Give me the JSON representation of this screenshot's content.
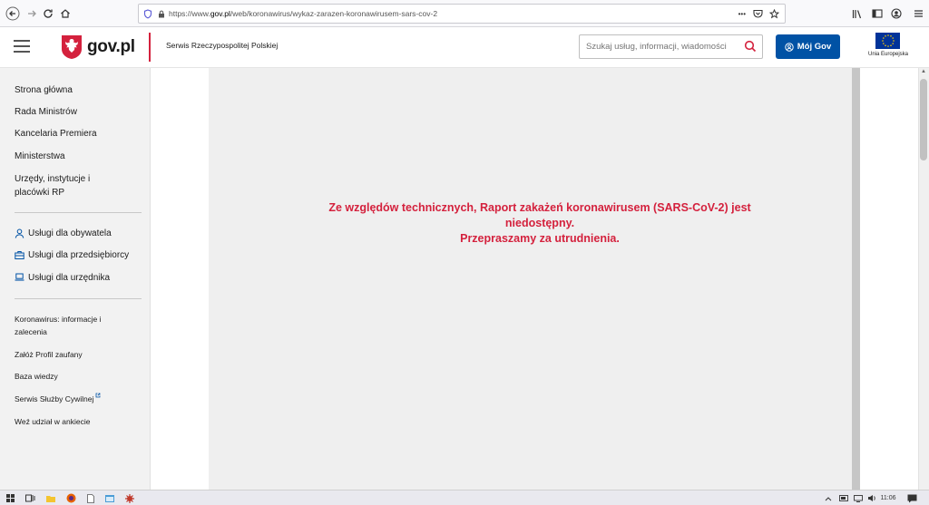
{
  "browser": {
    "url_prefix": "https://www.",
    "url_host": "gov.pl",
    "url_path": "/web/koronawirus/wykaz-zarazen-koronawirusem-sars-cov-2",
    "page_actions": "•••"
  },
  "header": {
    "logo_text": "gov.pl",
    "service_name": "Serwis Rzeczypospolitej Polskiej",
    "search_placeholder": "Szukaj usług, informacji, wiadomości",
    "moj_gov_label": "Mój Gov",
    "eu_label": "Unia Europejska"
  },
  "sidebar": {
    "main_items": [
      {
        "label": "Strona główna"
      },
      {
        "label": "Rada Ministrów"
      },
      {
        "label": "Kancelaria Premiera"
      },
      {
        "label": "Ministerstwa"
      },
      {
        "label": "Urzędy, instytucje i placówki RP"
      }
    ],
    "service_items": [
      {
        "label": "Usługi dla obywatela",
        "icon": "person-icon"
      },
      {
        "label": "Usługi dla przedsiębiorcy",
        "icon": "briefcase-icon"
      },
      {
        "label": "Usługi dla urzędnika",
        "icon": "laptop-icon"
      }
    ],
    "extra_items": [
      {
        "label": "Koronawirus: informacje i zalecenia"
      },
      {
        "label": "Załóż Profil zaufany"
      },
      {
        "label": "Baza wiedzy"
      },
      {
        "label": "Serwis Służby Cywilnej"
      },
      {
        "label": "Weź udział w ankiecie"
      }
    ]
  },
  "main": {
    "error_line1": "Ze względów technicznych, Raport zakażeń koronawirusem (SARS-CoV-2) jest niedostępny.",
    "error_line2": "Przepraszamy za utrudnienia."
  },
  "taskbar": {
    "time": "11:06"
  },
  "colors": {
    "gov_red": "#d4213d",
    "gov_blue": "#0052a5",
    "eu_blue": "#003399"
  }
}
